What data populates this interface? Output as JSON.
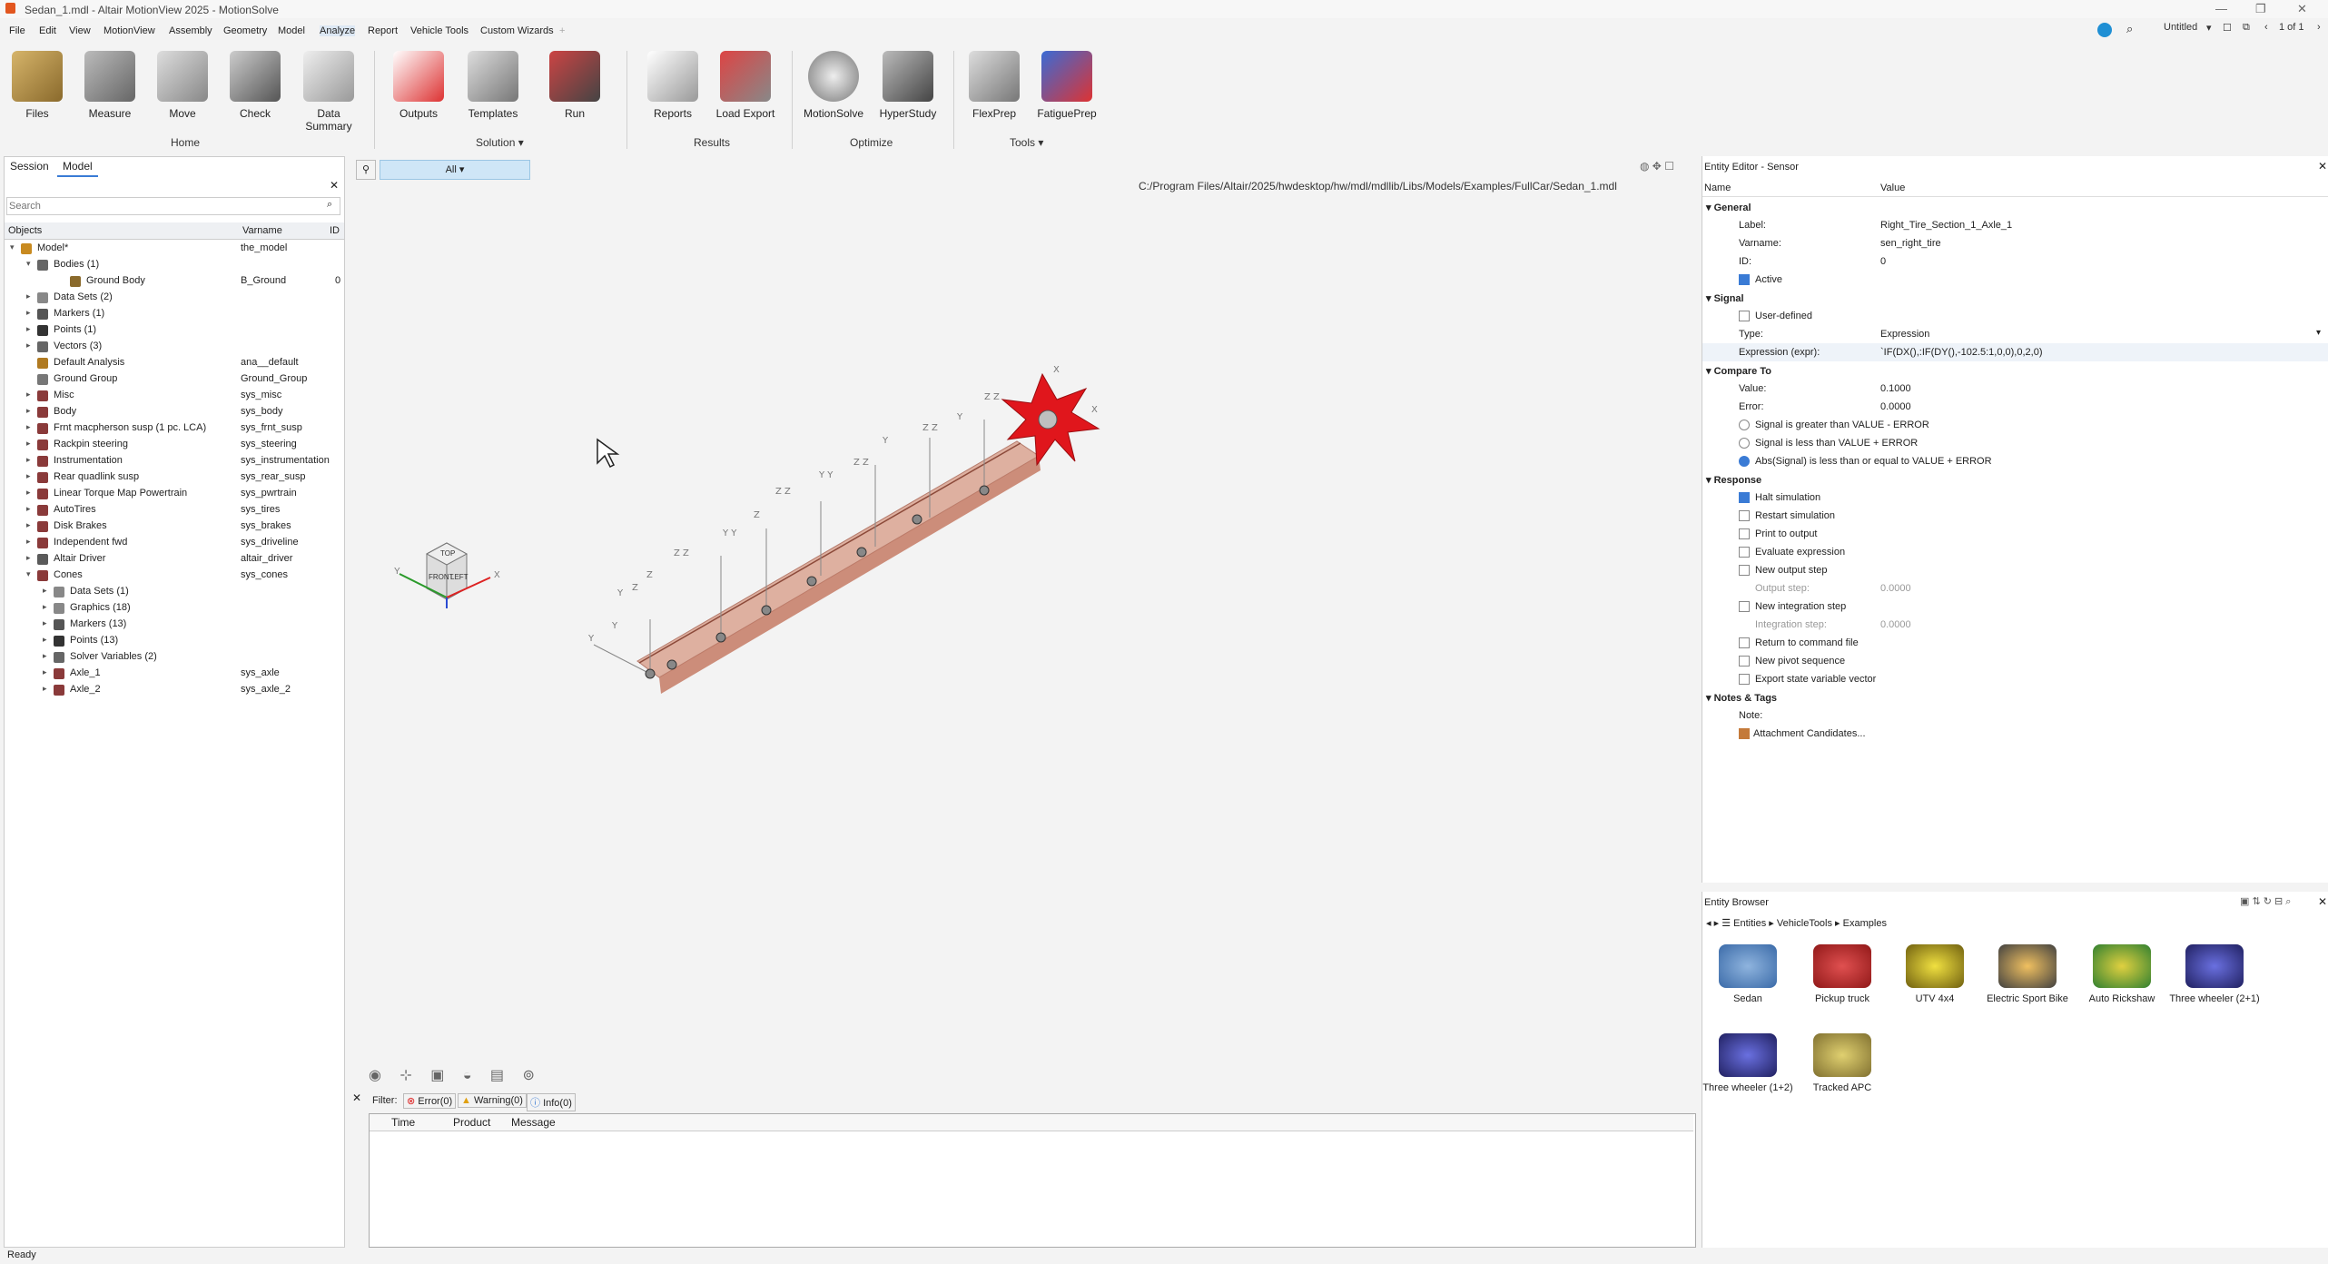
{
  "window": {
    "title": "Sedan_1.mdl - Altair MotionView 2025 - MotionSolve",
    "controls": [
      "—",
      "❐",
      "✕"
    ]
  },
  "menu": [
    "File",
    "Edit",
    "View",
    "MotionView",
    "Assembly",
    "Geometry",
    "Model",
    "Analyze",
    "Report",
    "Vehicle Tools",
    "Custom Wizards"
  ],
  "menu_right": {
    "workspace": "Untitled",
    "pages": "1 of 1"
  },
  "ribbon": {
    "buttons": [
      "Files",
      "Measure",
      "Move",
      "Check",
      "Data Summary",
      "Outputs",
      "Templates",
      "Run",
      "Reports",
      "Load Export",
      "MotionSolve",
      "HyperStudy",
      "FlexPrep",
      "FatiguePrep"
    ],
    "groups": [
      "Home",
      "Solution",
      "Results",
      "Optimize",
      "Tools"
    ]
  },
  "left_panel": {
    "tabs": [
      "Session",
      "Model"
    ],
    "search_placeholder": "Search",
    "columns": [
      "Objects",
      "Varname",
      "ID"
    ],
    "tree": [
      {
        "label": "Model*",
        "var": "the_model",
        "id": ""
      },
      {
        "label": "Bodies (1)",
        "var": "",
        "id": ""
      },
      {
        "label": "Ground Body",
        "var": "B_Ground",
        "id": "0"
      },
      {
        "label": "Data Sets (2)",
        "var": "",
        "id": ""
      },
      {
        "label": "Markers (1)",
        "var": "",
        "id": ""
      },
      {
        "label": "Points (1)",
        "var": "",
        "id": ""
      },
      {
        "label": "Vectors (3)",
        "var": "",
        "id": ""
      },
      {
        "label": "Default Analysis",
        "var": "ana__default",
        "id": ""
      },
      {
        "label": "Ground Group",
        "var": "Ground_Group",
        "id": ""
      },
      {
        "label": "Misc",
        "var": "sys_misc",
        "id": ""
      },
      {
        "label": "Body",
        "var": "sys_body",
        "id": ""
      },
      {
        "label": "Frnt macpherson susp (1 pc. LCA)",
        "var": "sys_frnt_susp",
        "id": ""
      },
      {
        "label": "Rackpin steering",
        "var": "sys_steering",
        "id": ""
      },
      {
        "label": "Instrumentation",
        "var": "sys_instrumentation",
        "id": ""
      },
      {
        "label": "Rear quadlink susp",
        "var": "sys_rear_susp",
        "id": ""
      },
      {
        "label": "Linear Torque Map Powertrain",
        "var": "sys_pwrtrain",
        "id": ""
      },
      {
        "label": "AutoTires",
        "var": "sys_tires",
        "id": ""
      },
      {
        "label": "Disk Brakes",
        "var": "sys_brakes",
        "id": ""
      },
      {
        "label": "Independent fwd",
        "var": "sys_driveline",
        "id": ""
      },
      {
        "label": "Altair Driver",
        "var": "altair_driver",
        "id": ""
      },
      {
        "label": "Cones",
        "var": "sys_cones",
        "id": ""
      },
      {
        "label": "Data Sets (1)",
        "var": "",
        "id": ""
      },
      {
        "label": "Graphics (18)",
        "var": "",
        "id": ""
      },
      {
        "label": "Markers (13)",
        "var": "",
        "id": ""
      },
      {
        "label": "Points (13)",
        "var": "",
        "id": ""
      },
      {
        "label": "Solver Variables (2)",
        "var": "",
        "id": ""
      },
      {
        "label": "Axle_1",
        "var": "sys_axle",
        "id": ""
      },
      {
        "label": "Axle_2",
        "var": "sys_axle_2",
        "id": ""
      }
    ]
  },
  "viewport": {
    "filter": "All",
    "path": "C:/Program Files/Altair/2025/hwdesktop/hw/mdl/mdllib/Libs/Models/Examples/FullCar/Sedan_1.mdl",
    "cube_labels": [
      "TOP",
      "FRONT",
      "LEFT"
    ],
    "axis_labels": [
      "Y",
      "X"
    ]
  },
  "messages": {
    "filter_label": "Filter:",
    "filters": [
      "Error(0)",
      "Warning(0)",
      "Info(0)"
    ],
    "columns": [
      "Time",
      "Product",
      "Message"
    ]
  },
  "editor": {
    "title": "Entity Editor - Sensor",
    "col_name": "Name",
    "col_value": "Value",
    "sections": {
      "general": "General",
      "signal": "Signal",
      "compare": "Compare To",
      "response": "Response",
      "notes": "Notes & Tags"
    },
    "label_key": "Label:",
    "label_val": "Right_Tire_Section_1_Axle_1",
    "varname_key": "Varname:",
    "varname_val": "sen_right_tire",
    "id_key": "ID:",
    "id_val": "0",
    "active": "Active",
    "userdefined": "User-defined",
    "type_key": "Type:",
    "type_val": "Expression",
    "expr_key": "Expression (expr):",
    "expr_val": "`IF(DX(),:IF(DY(),-102.5:1,0,0),0,2,0)",
    "value_key": "Value:",
    "value_val": "0.1000",
    "error_key": "Error:",
    "error_val": "0.0000",
    "radios": [
      "Signal is greater than VALUE - ERROR",
      "Signal is less than VALUE + ERROR",
      "Abs(Signal) is less than or equal to VALUE + ERROR"
    ],
    "response": [
      "Halt simulation",
      "Restart simulation",
      "Print to output",
      "Evaluate expression",
      "New output step"
    ],
    "output_step_key": "Output step:",
    "output_step_val": "0.0000",
    "new_integration": "New integration step",
    "integration_step_key": "Integration step:",
    "integration_step_val": "0.0000",
    "more": [
      "Return to command file",
      "New pivot sequence",
      "Export state variable vector"
    ],
    "note_key": "Note:",
    "attachment": "Attachment Candidates..."
  },
  "browser": {
    "title": "Entity Browser",
    "breadcrumb": [
      "Entities",
      "VehicleTools",
      "Examples"
    ],
    "items": [
      "Sedan",
      "Pickup truck",
      "UTV 4x4",
      "Electric Sport Bike",
      "Auto Rickshaw",
      "Three wheeler (2+1)",
      "Three wheeler (1+2)",
      "Tracked APC"
    ]
  },
  "status": "Ready",
  "colors": {
    "accent": "#3a7bd5",
    "bar": "#c9826a",
    "star": "#e0161c"
  }
}
